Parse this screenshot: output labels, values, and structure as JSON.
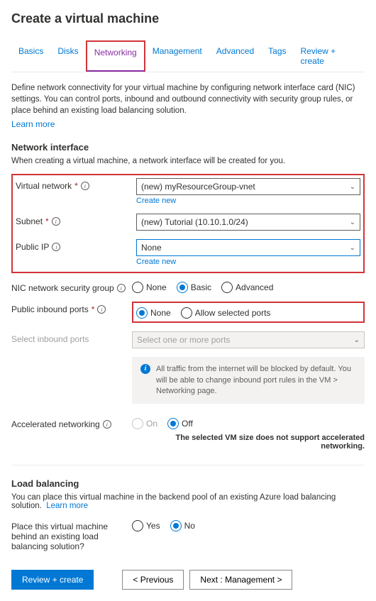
{
  "title": "Create a virtual machine",
  "tabs": [
    "Basics",
    "Disks",
    "Networking",
    "Management",
    "Advanced",
    "Tags",
    "Review + create"
  ],
  "activeTab": "Networking",
  "intro": "Define network connectivity for your virtual machine by configuring network interface card (NIC) settings. You can control ports, inbound and outbound connectivity with security group rules, or place behind an existing load balancing solution.",
  "learnMore": "Learn more",
  "sections": {
    "ni": {
      "heading": "Network interface",
      "sub": "When creating a virtual machine, a network interface will be created for you."
    },
    "lb": {
      "heading": "Load balancing",
      "sub": "You can place this virtual machine in the backend pool of an existing Azure load balancing solution.",
      "learn": "Learn more"
    }
  },
  "fields": {
    "vnet": {
      "label": "Virtual network",
      "value": "(new) myResourceGroup-vnet",
      "create": "Create new"
    },
    "subnet": {
      "label": "Subnet",
      "value": "(new) Tutorial (10.10.1.0/24)"
    },
    "pip": {
      "label": "Public IP",
      "value": "None",
      "create": "Create new"
    },
    "nsg": {
      "label": "NIC network security group",
      "options": [
        "None",
        "Basic",
        "Advanced"
      ],
      "selected": "Basic"
    },
    "inbound": {
      "label": "Public inbound ports",
      "options": [
        "None",
        "Allow selected ports"
      ],
      "selected": "None"
    },
    "selports": {
      "label": "Select inbound ports",
      "placeholder": "Select one or more ports"
    },
    "msg": "All traffic from the internet will be blocked by default. You will be able to change inbound port rules in the VM > Networking page.",
    "accel": {
      "label": "Accelerated networking",
      "options": [
        "On",
        "Off"
      ],
      "selected": "Off",
      "warn": "The selected VM size does not support accelerated networking."
    },
    "lbq": {
      "label": "Place this virtual machine behind an existing load balancing solution?",
      "options": [
        "Yes",
        "No"
      ],
      "selected": "No"
    }
  },
  "footer": {
    "review": "Review + create",
    "prev": "< Previous",
    "next": "Next : Management >"
  }
}
